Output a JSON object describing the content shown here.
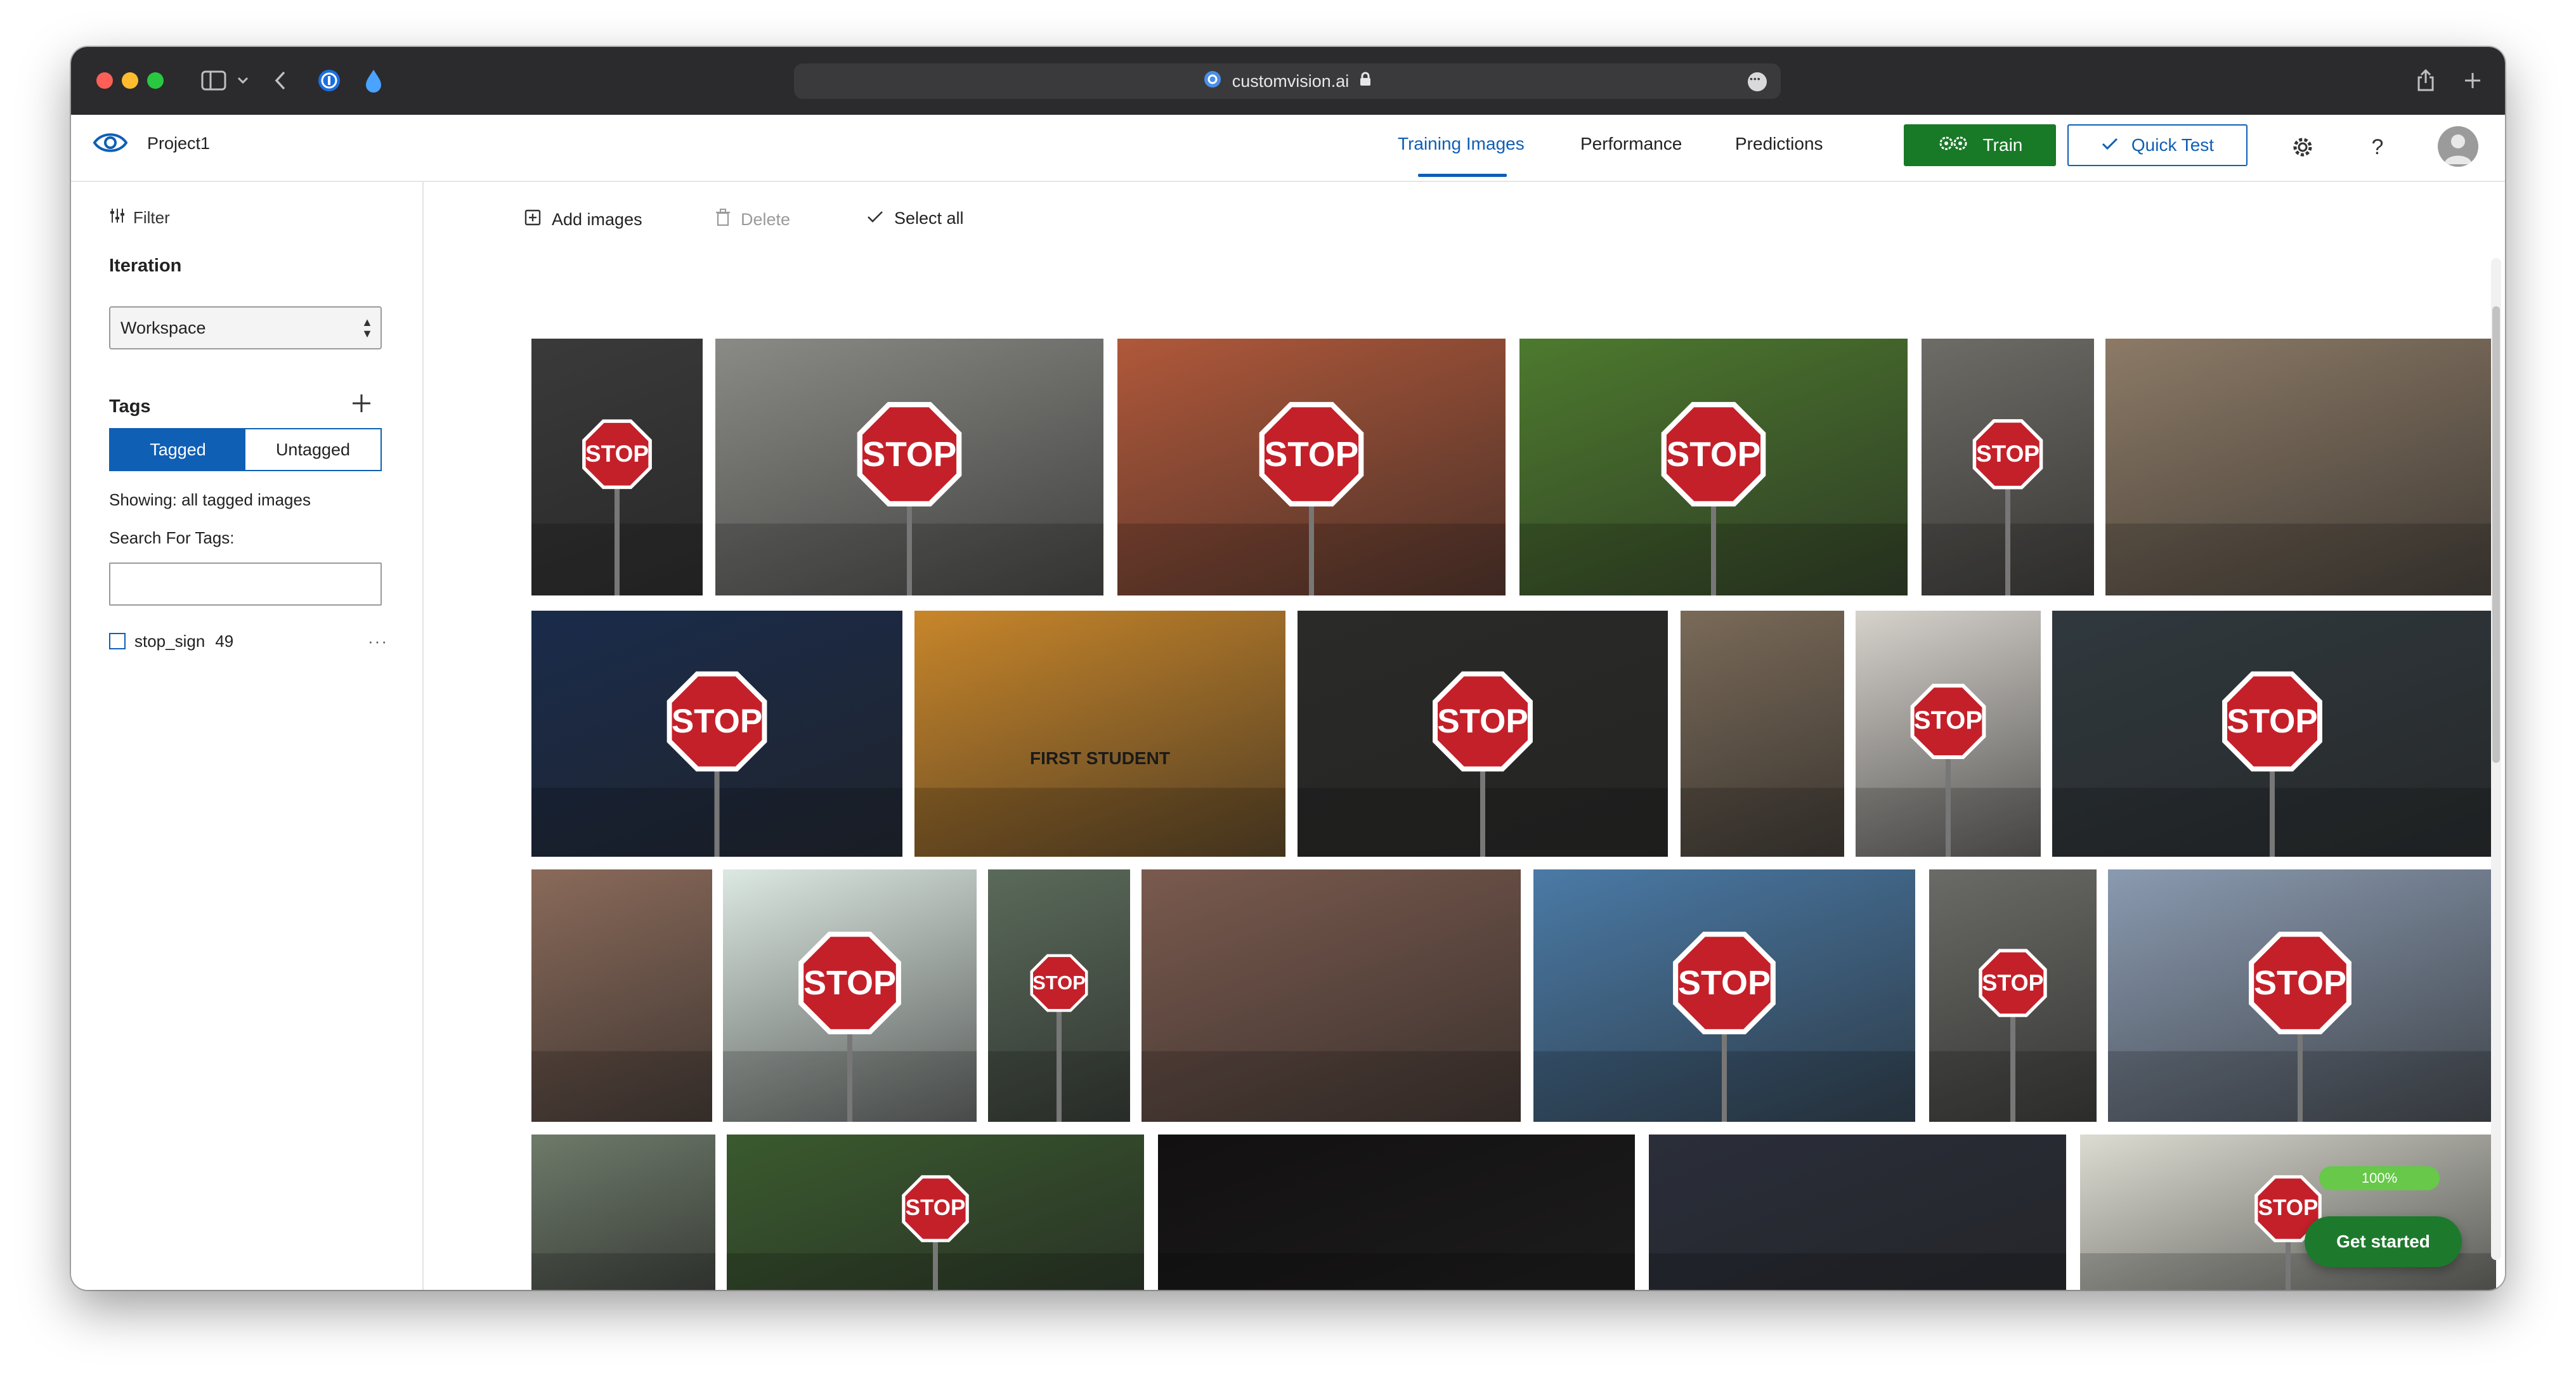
{
  "browser": {
    "url": "customvision.ai"
  },
  "header": {
    "project_name": "Project1",
    "tabs": [
      {
        "label": "Training Images",
        "active": true
      },
      {
        "label": "Performance",
        "active": false
      },
      {
        "label": "Predictions",
        "active": false
      }
    ],
    "train_label": "Train",
    "quick_test_label": "Quick Test",
    "help_label": "?"
  },
  "sidebar": {
    "filter_label": "Filter",
    "iteration_title": "Iteration",
    "iteration_value": "Workspace",
    "tags_title": "Tags",
    "tagged_label": "Tagged",
    "untagged_label": "Untagged",
    "showing_text": "Showing: all tagged images",
    "search_label": "Search For Tags:",
    "search_value": "",
    "tags": [
      {
        "name": "stop_sign",
        "count": "49"
      }
    ]
  },
  "toolbar": {
    "add_images_label": "Add images",
    "delete_label": "Delete",
    "select_all_label": "Select all"
  },
  "gallery": {
    "images": [
      {
        "name": "stop-sign-forest-bw",
        "sign_text": "STOP",
        "bg": "#3a3a3a"
      },
      {
        "name": "stop-sign-graffiti-box",
        "sign_text": "STOP",
        "bg": "#8a8a86"
      },
      {
        "name": "stop-sign-red-rock",
        "sign_text": "STOP",
        "bg": "#b0583a"
      },
      {
        "name": "stop-sign-trees-closeup",
        "sign_text": "STOP",
        "bg": "#4d7a2e"
      },
      {
        "name": "stop-sign-alley-narrow",
        "sign_text": "STOP",
        "bg": "#6e6c66"
      },
      {
        "name": "stop-sign-aerial-railroad",
        "sign_text": "",
        "bg": "#8c7a66"
      },
      {
        "name": "stop-sign-dark-blue-night",
        "sign_text": "STOP",
        "bg": "#1a2b4a"
      },
      {
        "name": "stop-sign-school-bus",
        "sign_text": "FIRST STUDENT",
        "bg": "#c8862a"
      },
      {
        "name": "stop-sign-garage-cones",
        "sign_text": "STOP",
        "bg": "#2a2a28"
      },
      {
        "name": "stop-sign-city-taxi",
        "sign_text": "",
        "bg": "#7a6a58"
      },
      {
        "name": "stop-sign-flower",
        "sign_text": "STOP",
        "bg": "#d6d2cc"
      },
      {
        "name": "stop-sign-bridge-arrow",
        "sign_text": "STOP",
        "bg": "#30393e"
      },
      {
        "name": "stop-sign-brick-street",
        "sign_text": "",
        "bg": "#8a6a5a"
      },
      {
        "name": "stop-sign-procrastination",
        "sign_text": "STOP",
        "bg": "#dce8e2"
      },
      {
        "name": "stop-sign-tilted-trees",
        "sign_text": "STOP",
        "bg": "#5a6a5a"
      },
      {
        "name": "stop-sign-woman-street",
        "sign_text": "",
        "bg": "#7a5a4e"
      },
      {
        "name": "stop-sign-mountains-no-stopping",
        "sign_text": "STOP",
        "bg": "#4a7aa6"
      },
      {
        "name": "stop-sign-bare-tree",
        "sign_text": "STOP",
        "bg": "#6a6a66"
      },
      {
        "name": "stop-sign-glass-buildings",
        "sign_text": "STOP",
        "bg": "#8a9ab0"
      },
      {
        "name": "stop-sign-taxi-street",
        "sign_text": "",
        "bg": "#6e7a6a"
      },
      {
        "name": "stop-sign-bushes",
        "sign_text": "STOP",
        "bg": "#3a5a2e"
      },
      {
        "name": "stop-sign-dark-night",
        "sign_text": "",
        "bg": "#121010"
      },
      {
        "name": "stop-sign-street-lamp-bus",
        "sign_text": "",
        "bg": "#2a2e3a"
      },
      {
        "name": "stop-sign-large-closeup",
        "sign_text": "STOP",
        "bg": "#dcdcd2"
      }
    ]
  },
  "onboarding": {
    "progress_label": "100%",
    "progress": 1.0,
    "get_started_label": "Get started"
  },
  "colors": {
    "accent": "#0f5fb5",
    "train_green": "#187927",
    "stop_red": "#c4202a"
  }
}
